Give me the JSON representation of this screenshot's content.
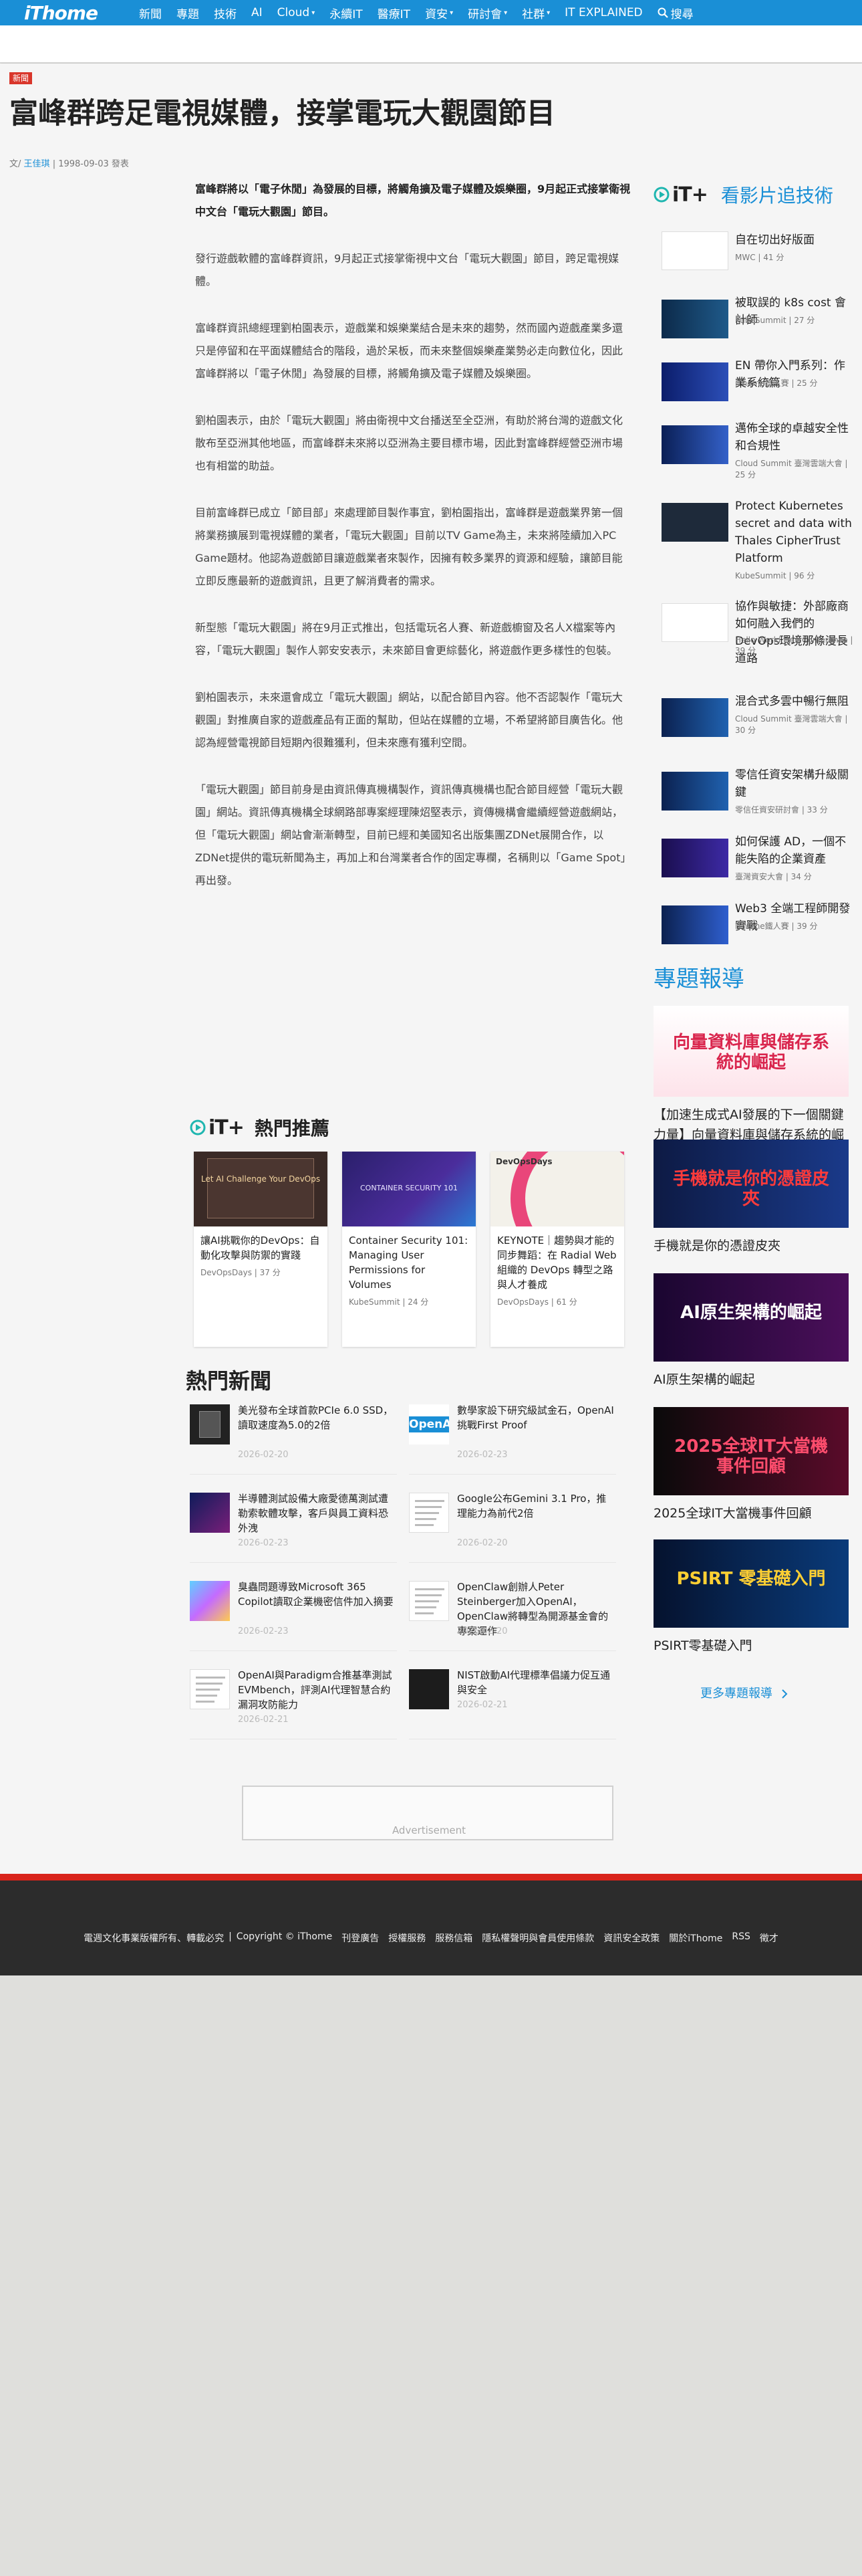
{
  "nav": {
    "logo": "iThome",
    "items": [
      {
        "label": "新聞",
        "caret": false
      },
      {
        "label": "專題",
        "caret": false
      },
      {
        "label": "技術",
        "caret": false
      },
      {
        "label": "AI",
        "caret": false
      },
      {
        "label": "Cloud",
        "caret": true
      },
      {
        "label": "永續IT",
        "caret": false
      },
      {
        "label": "醫療IT",
        "caret": false
      },
      {
        "label": "資安",
        "caret": true
      },
      {
        "label": "研討會",
        "caret": true
      },
      {
        "label": "社群",
        "caret": true
      },
      {
        "label": "IT EXPLAINED",
        "caret": false
      }
    ],
    "search_label": "搜尋"
  },
  "article": {
    "tag": "新聞",
    "title": "富峰群跨足電視媒體，接掌電玩大觀園節目",
    "byline_prefix": "文/",
    "author": "王佳琪",
    "date": "1998-09-03 發表",
    "lead": "富峰群將以「電子休閒」為發展的目標，將觸角擴及電子媒體及娛樂圈，9月起正式接掌衛視中文台「電玩大觀園」節目。",
    "paragraphs": [
      "發行遊戲軟體的富峰群資訊，9月起正式接掌衛視中文台「電玩大觀園」節目，跨足電視媒體。",
      "富峰群資訊總經理劉柏園表示，遊戲業和娛樂業結合是未來的趨勢，然而國內遊戲產業多還只是停留和在平面媒體結合的階段，過於呆板，而未來整個娛樂產業勢必走向數位化，因此富峰群將以「電子休閒」為發展的目標，將觸角擴及電子媒體及娛樂圈。",
      "劉柏園表示，由於「電玩大觀園」將由衛視中文台播送至全亞洲，有助於將台灣的遊戲文化散布至亞洲其他地區，而富峰群未來將以亞洲為主要目標市場，因此對富峰群經營亞洲市場也有相當的助益。",
      "目前富峰群已成立「節目部」來處理節目製作事宜，劉柏園指出，富峰群是遊戲業界第一個將業務擴展到電視媒體的業者，「電玩大觀園」目前以TV Game為主，未來將陸續加入PC Game題材。他認為遊戲節目讓遊戲業者來製作，因擁有較多業界的資源和經驗，讓節目能立即反應最新的遊戲資訊，且更了解消費者的需求。",
      "新型態「電玩大觀園」將在9月正式推出，包括電玩名人賽、新遊戲櫥窗及名人X檔案等內容，「電玩大觀園」製作人郭安安表示，未來節目會更綜藝化，將遊戲作更多樣性的包裝。",
      "劉柏園表示，未來還會成立「電玩大觀園」網站，以配合節目內容。他不否認製作「電玩大觀園」對推廣自家的遊戲產品有正面的幫助，但站在媒體的立場，不希望將節目廣告化。他認為經營電視節目短期內很難獲利，但未來應有獲利空間。",
      "「電玩大觀園」節目前身是由資訊傳真機構製作，資訊傳真機構也配合節目經營「電玩大觀園」網站。資訊傳真機構全球網路部專案經理陳炤堅表示，資傳機構會繼續經營遊戲網站，但「電玩大觀園」網站會漸漸轉型，目前已經和美國知名出版集團ZDNet展開合作，以ZDNet提供的電玩新聞為主，再加上和台灣業者合作的固定專欄，名稱則以「Game Spot」再出發。"
    ]
  },
  "recommend": {
    "brand": "iT+",
    "heading": "熱門推薦",
    "cards": [
      {
        "title": "讓AI挑戰你的DevOps：自動化攻擊與防禦的實踐",
        "meta": "DevOpsDays | 37 分",
        "thumb_text": "Let AI Challenge Your DevOps"
      },
      {
        "title": "Container Security 101: Managing User Permissions for Volumes",
        "meta": "KubeSummit | 24 分",
        "thumb_text": "CONTAINER SECURITY 101"
      },
      {
        "title": "KEYNOTE｜趨勢與才能的同步舞蹈：在 Radial Web 組織的 DevOps 轉型之路與人才養成",
        "meta": "DevOpsDays | 61 分",
        "thumb_text": "DevOpsDays"
      }
    ]
  },
  "hot_news": {
    "heading": "熱門新聞",
    "items": [
      {
        "title": "美光發布全球首款PCIe 6.0 SSD，讀取速度為5.0的2倍",
        "date": "2026-02-20",
        "icon": "ssd-icon"
      },
      {
        "title": "數學家設下研究級試金石，OpenAI挑戰First Proof",
        "date": "2026-02-23",
        "icon": "openai-logo-icon"
      },
      {
        "title": "半導體測試設備大廠愛德萬測試遭勒索軟體攻擊，客戶與員工資料恐外洩",
        "date": "2026-02-23",
        "icon": "circuit-icon"
      },
      {
        "title": "Google公布Gemini 3.1 Pro，推理能力為前代2倍",
        "date": "2026-02-20",
        "icon": "document-icon"
      },
      {
        "title": "臭蟲問題導致Microsoft 365 Copilot讀取企業機密信件加入摘要",
        "date": "2026-02-23",
        "icon": "copilot-icon"
      },
      {
        "title": "OpenClaw創辦人Peter Steinberger加入OpenAI，OpenClaw將轉型為開源基金會的專案運作",
        "date": "2026-02-20",
        "icon": "document-icon"
      },
      {
        "title": "OpenAI與Paradigm合推基準測試EVMbench，評測AI代理智慧合約漏洞攻防能力",
        "date": "2026-02-21",
        "icon": "diagram-icon"
      },
      {
        "title": "NIST啟動AI代理標準倡議力促互通與安全",
        "date": "2026-02-21",
        "icon": "nist-icon"
      }
    ]
  },
  "ad": {
    "label": "Advertisement"
  },
  "sidebar": {
    "brand": "iT+",
    "video_heading": "看影片追技術",
    "videos": [
      {
        "title": "自在切出好版面",
        "meta": "MWC | 41 分"
      },
      {
        "title": "被取誤的 k8s cost 會計師",
        "meta": "KubeSummit | 27 分"
      },
      {
        "title": "EN 帶你入門系列：作業系統篇",
        "meta": "iThome鐵人賽 | 25 分"
      },
      {
        "title": "邁佈全球的卓越安全性和合規性",
        "meta": "Cloud Summit 臺灣雲端大會 | 25 分"
      },
      {
        "title": "Protect Kubernetes secret and data with Thales CipherTrust Platform",
        "meta": "KubeSummit | 96 分"
      },
      {
        "title": "協作與敏捷：外部廠商如何融入我們的DevOps環境那條漫長道路",
        "meta": "Hello World Dev Conference | 39 分"
      },
      {
        "title": "混合式多雲中暢行無阻",
        "meta": "Cloud Summit 臺灣雲端大會 | 30 分"
      },
      {
        "title": "零信任資安架構升級關鍵",
        "meta": "零信任資安研討會 | 33 分"
      },
      {
        "title": "如何保護 AD，一個不能失陷的企業資產",
        "meta": "臺灣資安大會 | 34 分"
      },
      {
        "title": "Web3 全端工程師開發實戰",
        "meta": "iThome鐵人賽 | 39 分"
      }
    ],
    "topic_heading": "專題報導",
    "topics": [
      {
        "title": "【加速生成式AI發展的下一個關鍵力量】向量資料庫與儲存系統的崛起",
        "img_text": "向量資料庫與儲存系統的崛起"
      },
      {
        "title": "手機就是你的憑證皮夾",
        "img_text": "手機就是你的憑證皮夾"
      },
      {
        "title": "AI原生架構的崛起",
        "img_text": "AI原生架構的崛起"
      },
      {
        "title": "2025全球IT大當機事件回顧",
        "img_text": "2025全球IT大當機事件回顧"
      },
      {
        "title": "PSIRT零基礎入門",
        "img_text": "PSIRT 零基礎入門"
      }
    ],
    "more_label": "更多專題報導"
  },
  "footer": {
    "links": [
      "電週文化事業版權所有、轉載必究",
      "Copyright © iThome",
      "刊登廣告",
      "授權服務",
      "服務信箱",
      "隱私權聲明與會員使用條款",
      "資訊安全政策",
      "關於iThome",
      "RSS",
      "徵才"
    ]
  }
}
